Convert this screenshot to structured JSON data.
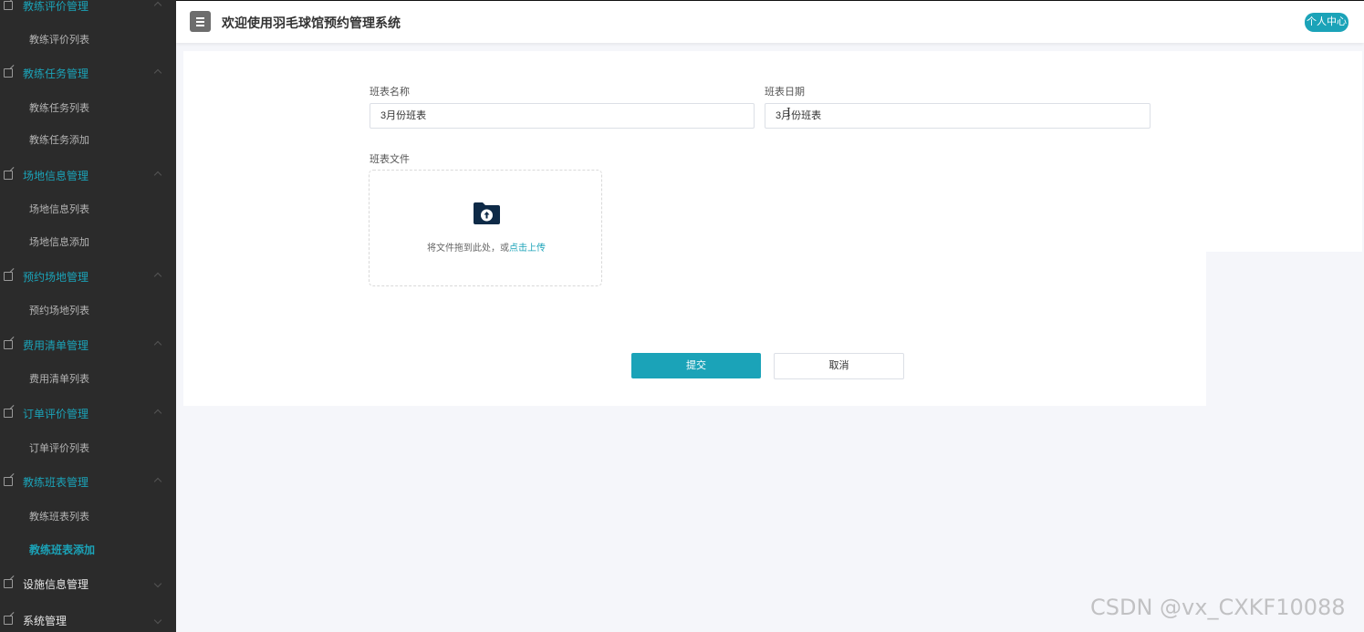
{
  "sidebar": {
    "groups": [
      {
        "label": "教练评价管理",
        "items": [
          "教练评价列表"
        ]
      },
      {
        "label": "教练任务管理",
        "items": [
          "教练任务列表",
          "教练任务添加"
        ]
      },
      {
        "label": "场地信息管理",
        "items": [
          "场地信息列表",
          "场地信息添加"
        ]
      },
      {
        "label": "预约场地管理",
        "items": [
          "预约场地列表"
        ]
      },
      {
        "label": "费用清单管理",
        "items": [
          "费用清单列表"
        ]
      },
      {
        "label": "订单评价管理",
        "items": [
          "订单评价列表"
        ]
      },
      {
        "label": "教练班表管理",
        "items": [
          "教练班表列表",
          "教练班表添加"
        ]
      },
      {
        "label": "设施信息管理",
        "items": []
      },
      {
        "label": "系统管理",
        "items": []
      }
    ],
    "active_item": "教练班表添加"
  },
  "header": {
    "title": "欢迎使用羽毛球馆预约管理系统",
    "user_center": "个人中心"
  },
  "form": {
    "name_label": "班表名称",
    "name_value": "3月份班表",
    "date_label": "班表日期",
    "date_value": "3月份班表",
    "file_label": "班表文件",
    "upload_text": "将文件拖到此处，或",
    "upload_link": "点击上传",
    "submit_label": "提交",
    "cancel_label": "取消"
  },
  "colors": {
    "accent": "#1ba3b8",
    "sidebar_bg": "#2b2b2b",
    "page_bg": "#f5f6fa"
  },
  "icons": {
    "menu": "hamburger-icon",
    "group": "edit-icon",
    "upload": "folder-upload-icon"
  },
  "watermark": "CSDN @vx_CXKF10088"
}
